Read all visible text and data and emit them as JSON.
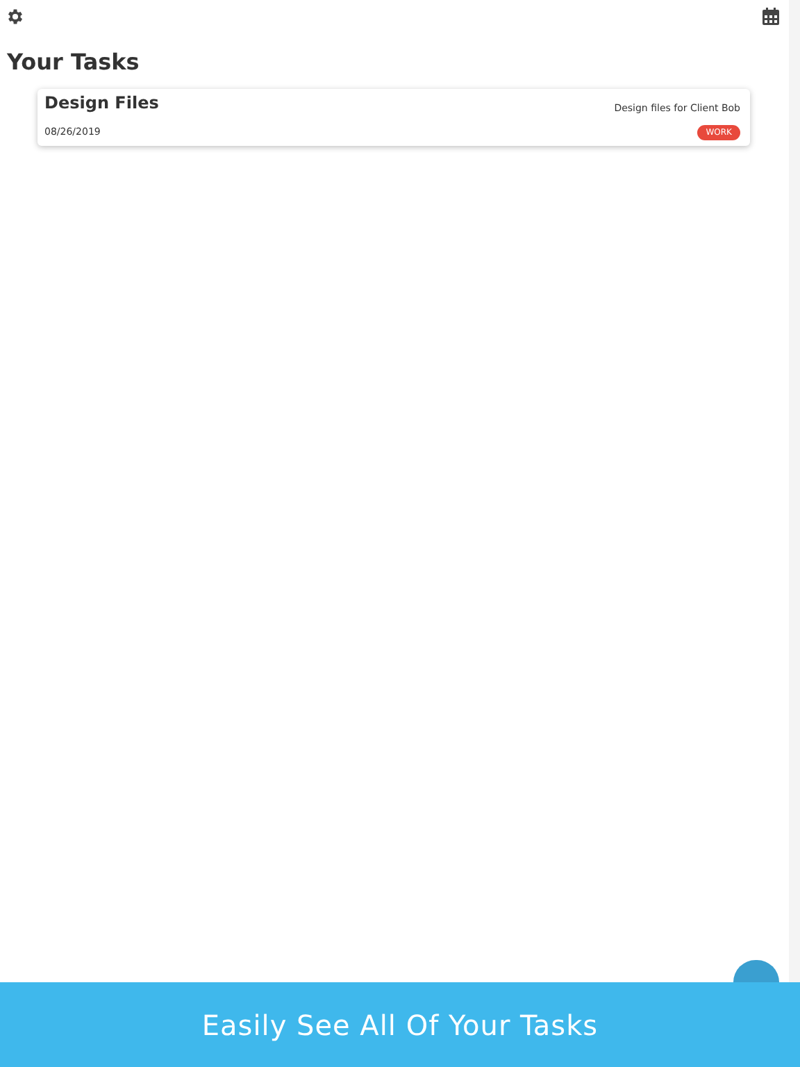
{
  "heading": "Your Tasks",
  "tasks": [
    {
      "title": "Design Files",
      "date": "08/26/2019",
      "description": "Design files for Client Bob",
      "tag": {
        "label": "WORK",
        "color": "#e8493c"
      }
    }
  ],
  "banner": {
    "text": "Easily See All Of Your Tasks"
  }
}
